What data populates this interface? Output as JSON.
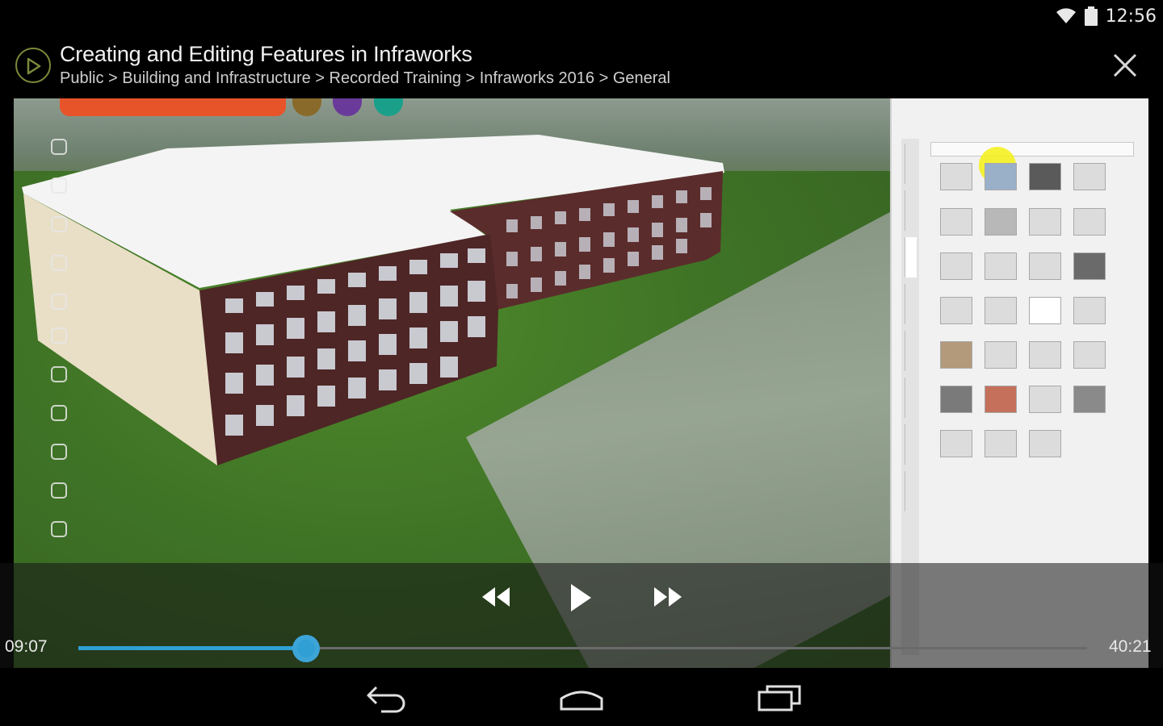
{
  "status_bar": {
    "time": "12:56",
    "icons": [
      "wifi-icon",
      "battery-icon"
    ]
  },
  "video": {
    "title": "Creating and Editing Features in Infraworks",
    "breadcrumb": "Public > Building and Infrastructure > Recorded Training > Infraworks 2016 > General",
    "icons": {
      "play": "play-circle-icon",
      "close": "close-icon"
    }
  },
  "player": {
    "current_time": "09:07",
    "total_time": "40:21",
    "progress": 0.226,
    "controls": [
      "rewind-icon",
      "play-icon",
      "fast-forward-icon"
    ],
    "accent_color": "#2f9fd4"
  },
  "navigation": {
    "buttons": [
      "back-icon",
      "home-icon",
      "recent-apps-icon"
    ]
  },
  "colors": {
    "background": "#000000",
    "toolbar_orange": "#e8542a"
  }
}
